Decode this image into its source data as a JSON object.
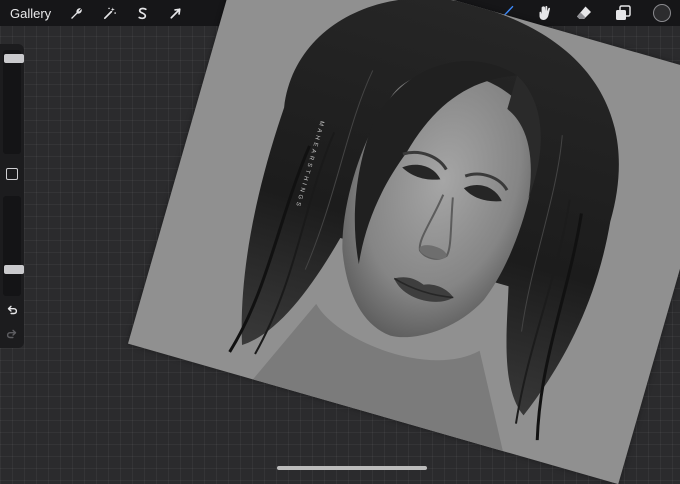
{
  "topbar": {
    "gallery_label": "Gallery",
    "left_tools": [
      {
        "name": "actions",
        "icon": "wrench-icon"
      },
      {
        "name": "adjustments",
        "icon": "magic-wand-icon"
      },
      {
        "name": "selection",
        "icon": "selection-s-icon"
      },
      {
        "name": "transform",
        "icon": "arrow-cursor-icon"
      }
    ],
    "right_tools": [
      {
        "name": "brush",
        "icon": "brush-icon",
        "active": true
      },
      {
        "name": "smudge",
        "icon": "smudge-icon",
        "active": false
      },
      {
        "name": "eraser",
        "icon": "eraser-icon",
        "active": false
      },
      {
        "name": "layers",
        "icon": "layers-icon",
        "active": false
      },
      {
        "name": "color",
        "icon": "color-swatch",
        "active": false
      }
    ],
    "accent_color": "#3d8cff",
    "current_color": "#2c2c2e"
  },
  "sidebar": {
    "brush_size_level": 0.95,
    "opacity_level": 0.35,
    "icons": [
      "modify-square-icon",
      "undo-icon",
      "redo-icon"
    ]
  },
  "canvas": {
    "artwork": "portrait",
    "watermark": "MAHEARSTHINGS"
  }
}
